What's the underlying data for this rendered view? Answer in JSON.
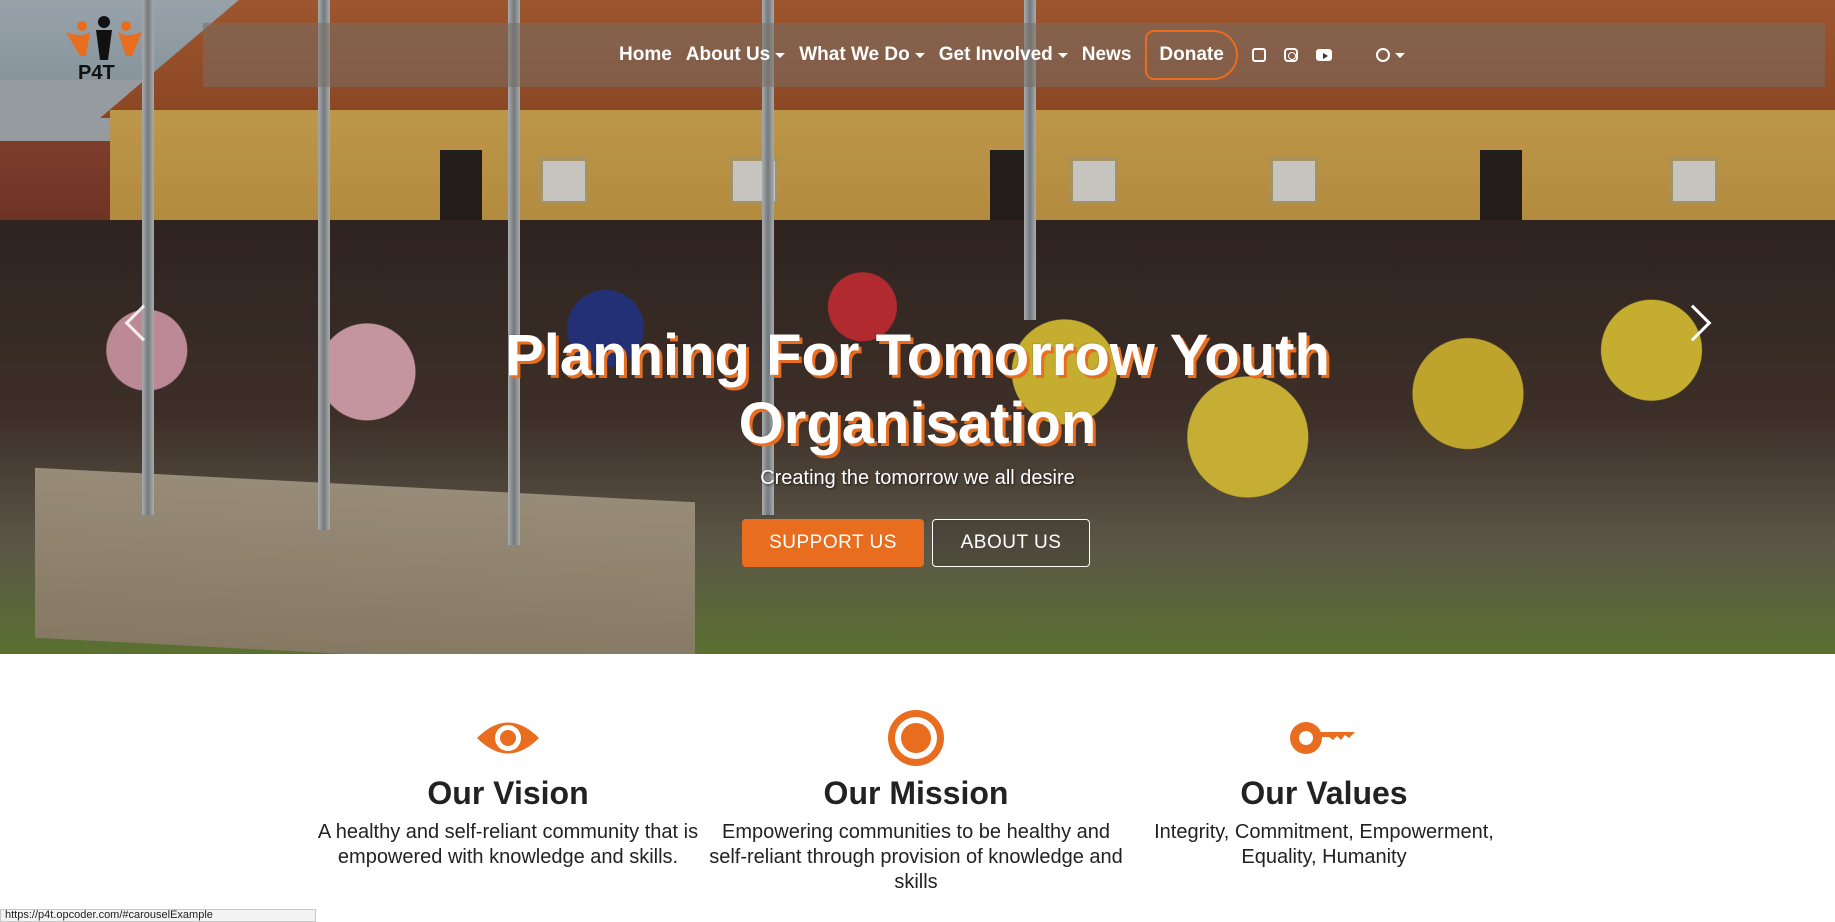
{
  "brand": {
    "logo_text": "P4T",
    "accent": "#e86d1f"
  },
  "nav": {
    "items": [
      {
        "label": "Home",
        "dropdown": false
      },
      {
        "label": "About Us",
        "dropdown": true
      },
      {
        "label": "What We Do",
        "dropdown": true
      },
      {
        "label": "Get Involved",
        "dropdown": true
      },
      {
        "label": "News",
        "dropdown": false
      }
    ],
    "donate_label": "Donate",
    "social_icons": [
      "facebook-icon",
      "instagram-icon",
      "youtube-icon"
    ],
    "language_icon": "globe-icon"
  },
  "hero": {
    "title": "Planning For Tomorrow Youth Organisation",
    "subtitle": "Creating the tomorrow we all desire",
    "support_label": "SUPPORT US",
    "about_label": "ABOUT US"
  },
  "features": [
    {
      "icon": "eye-icon",
      "title": "Our Vision",
      "text": "A healthy and self-reliant community that is empowered with knowledge and skills."
    },
    {
      "icon": "target-icon",
      "title": "Our Mission",
      "text": "Empowering communities to be healthy and self-reliant through provision of knowledge and skills"
    },
    {
      "icon": "key-icon",
      "title": "Our Values",
      "text": "Integrity, Commitment, Empowerment, Equality, Humanity"
    }
  ],
  "status_url": "https://p4t.opcoder.com/#carouselExample"
}
